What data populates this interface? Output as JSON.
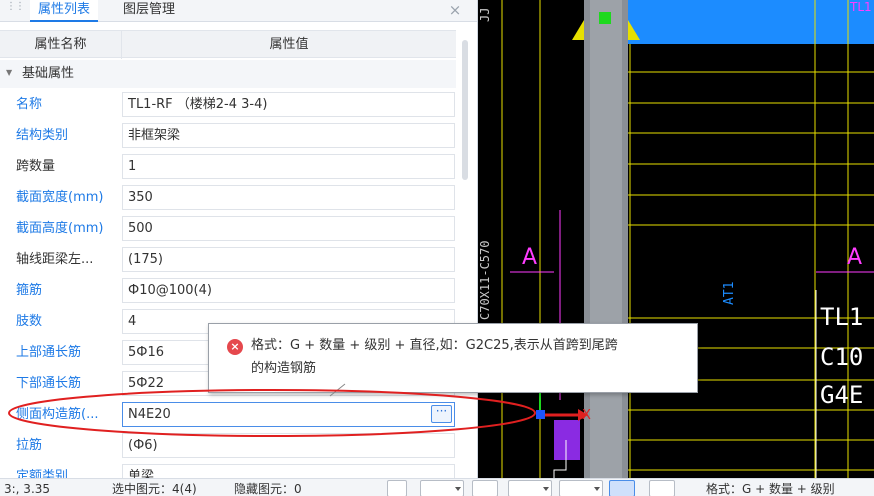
{
  "tabs": {
    "tab1": "属性列表",
    "tab2": "图层管理",
    "close": "×"
  },
  "table": {
    "col_name": "属性名称",
    "col_value": "属性值"
  },
  "group": {
    "label": "基础属性"
  },
  "props": [
    {
      "label": "名称",
      "value": "TL1-RF （楼梯2-4 3-4)"
    },
    {
      "label": "结构类别",
      "value": "非框架梁"
    },
    {
      "label": "跨数量",
      "value": "1"
    },
    {
      "label": "截面宽度(mm)",
      "value": "350"
    },
    {
      "label": "截面高度(mm)",
      "value": "500"
    },
    {
      "label": "轴线距梁左...",
      "value": "(175)"
    },
    {
      "label": "箍筋",
      "value": "Ф10@100(4)"
    },
    {
      "label": "肢数",
      "value": "4"
    },
    {
      "label": "上部通长筋",
      "value": "5Ф16"
    },
    {
      "label": "下部通长筋",
      "value": "5Ф22"
    },
    {
      "label": "侧面构造筋(...",
      "value": "N4E20"
    },
    {
      "label": "拉筋",
      "value": "(Ф6)"
    },
    {
      "label": "定额类别",
      "value": "单梁"
    }
  ],
  "tooltip": {
    "line1": "格式：G + 数量 + 级别 + 直径,如：G2C25,表示从首跨到尾跨",
    "line2": "的构造钢筋"
  },
  "canvas": {
    "label_a": "A",
    "label_at1": "AT1",
    "label_tl1": "TL1",
    "text_tl1": "TL1",
    "text_c10": "C10",
    "text_g4e": "G4E",
    "axis_x": "X",
    "vtext_top": "JJ",
    "vtext_side": "C70X11-C570"
  },
  "status": {
    "coord": "3:, 3.35",
    "selected": "选中图元：4(4)",
    "hidden": "隐藏图元：0",
    "hint": "格式：G + 数量 + 级别"
  },
  "colors": {
    "accent": "#1e7ae6",
    "cad_yellow": "#e7e000",
    "cad_magenta": "#ff3dff",
    "cad_blue": "#1c8cff",
    "annotation_red": "#e02020"
  }
}
